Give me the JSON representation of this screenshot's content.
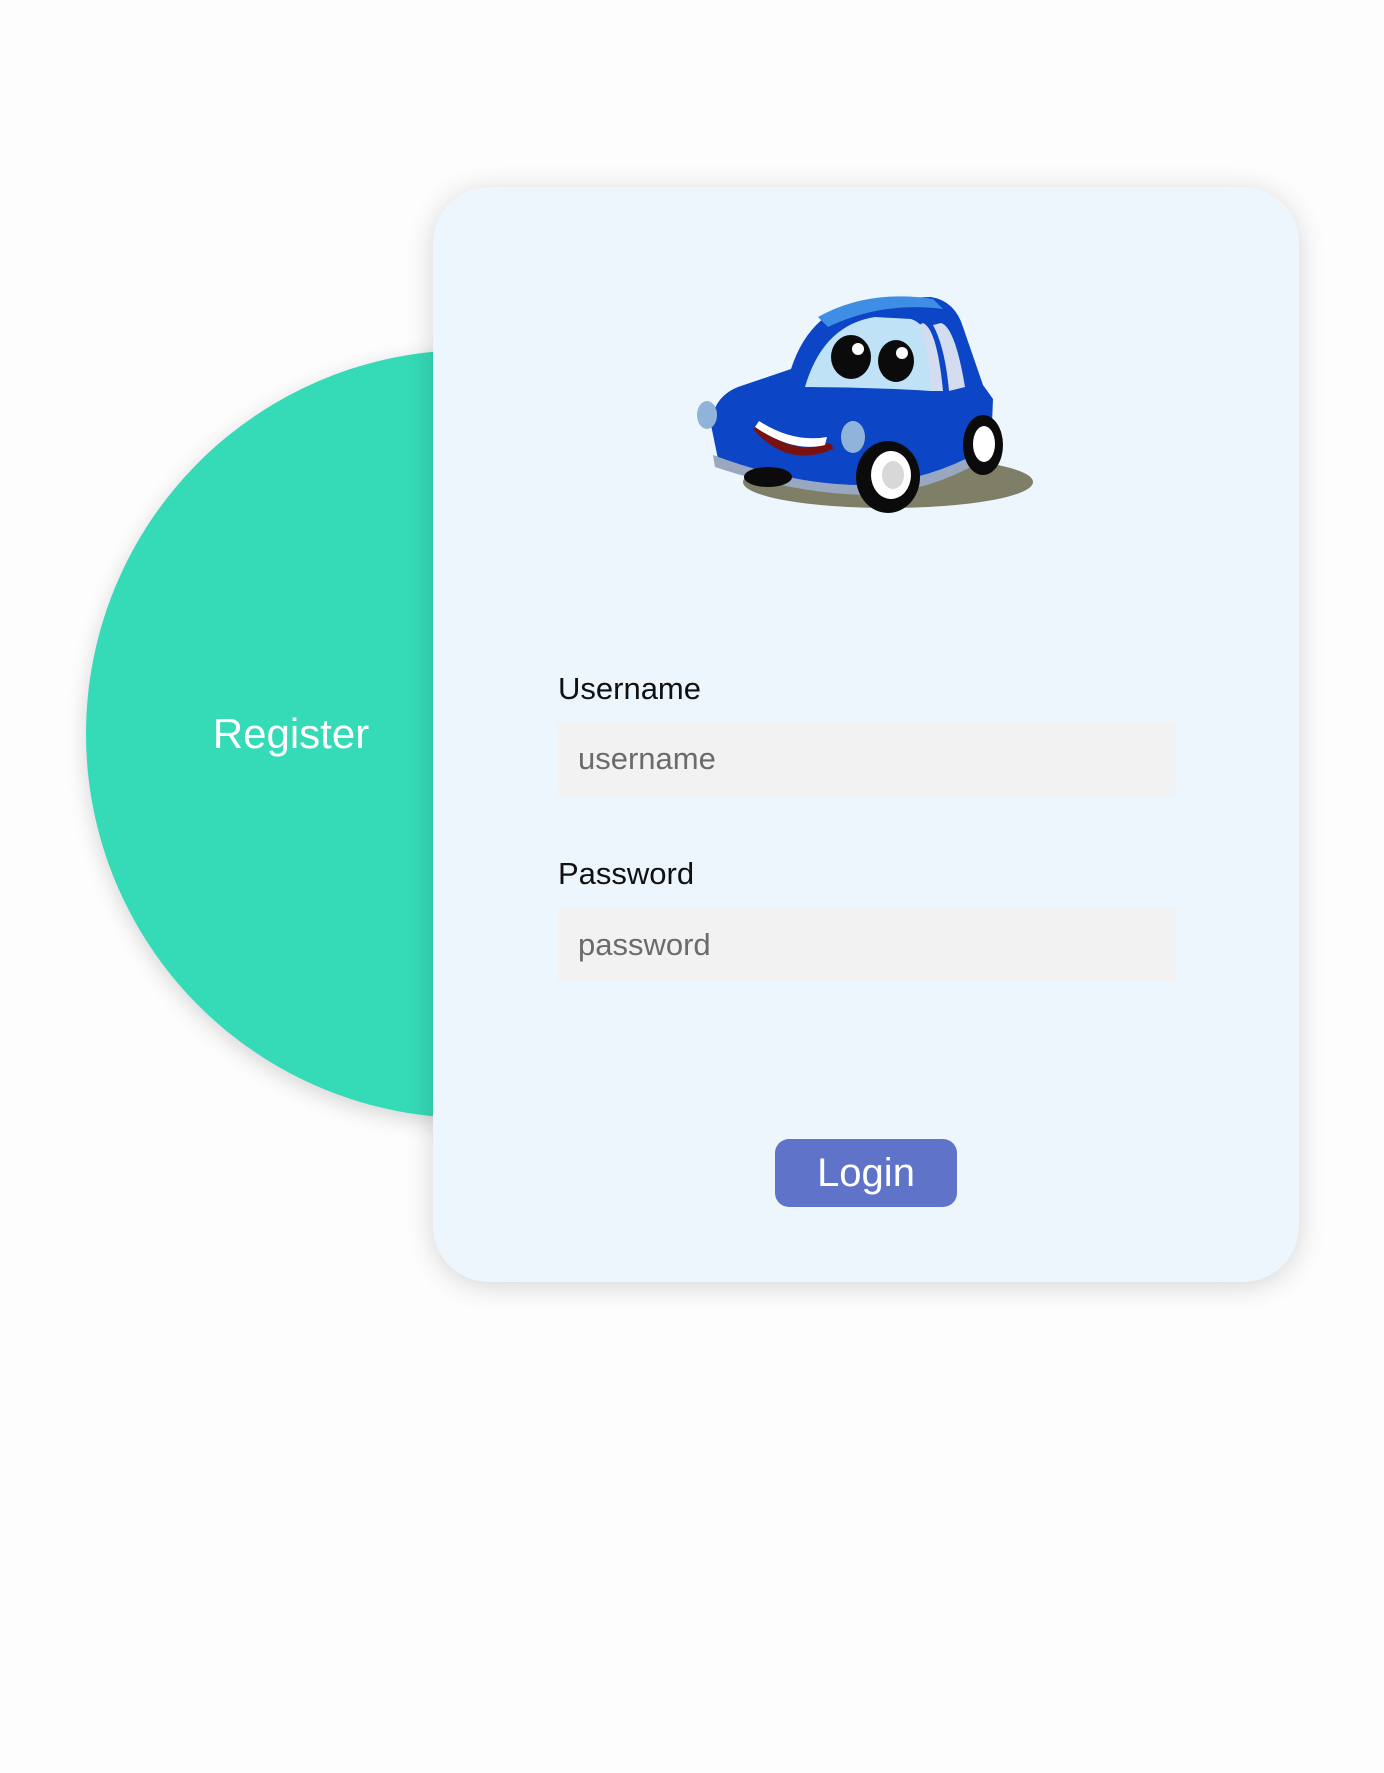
{
  "register": {
    "label": "Register",
    "color": "#35dab6"
  },
  "login_card": {
    "background": "#eef6fd",
    "mascot_icon": "blue-cartoon-car",
    "username": {
      "label": "Username",
      "placeholder": "username",
      "value": ""
    },
    "password": {
      "label": "Password",
      "placeholder": "password",
      "value": ""
    },
    "login_button": {
      "label": "Login",
      "color": "#5f73c9"
    }
  }
}
